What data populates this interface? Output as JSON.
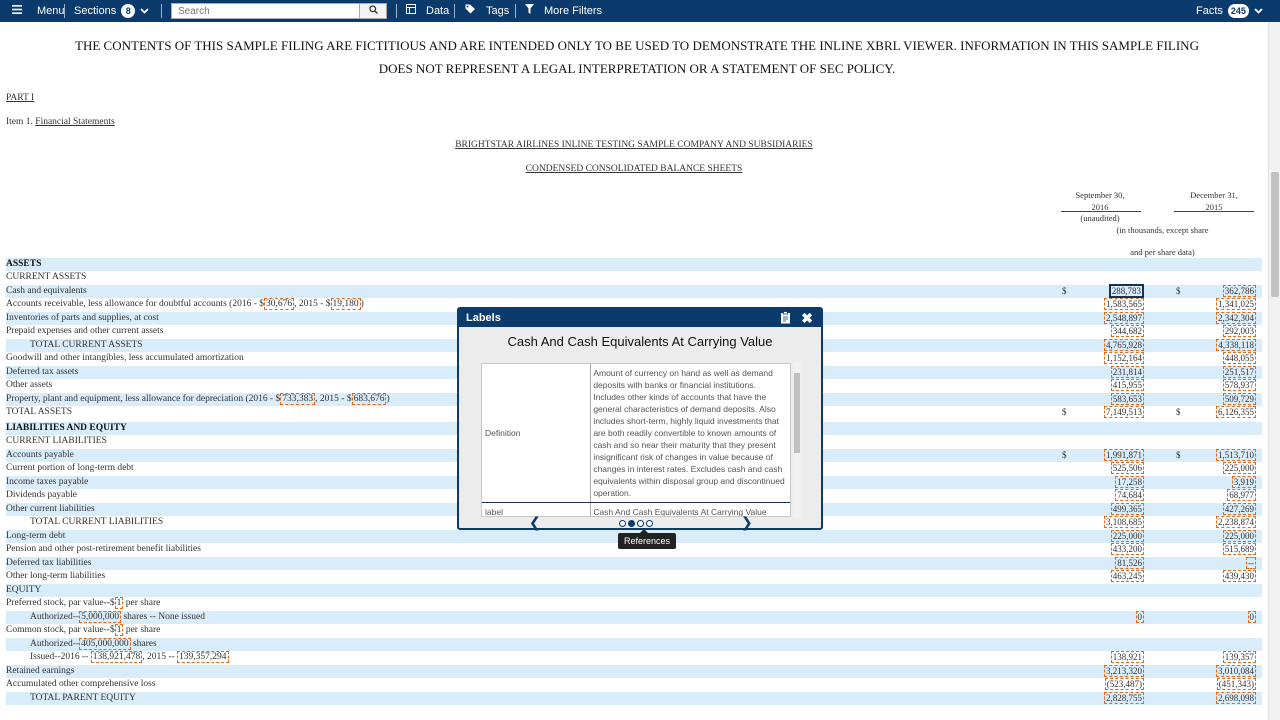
{
  "nav": {
    "menu": "Menu",
    "sections": "Sections",
    "sections_count": "8",
    "search_placeholder": "Search",
    "data": "Data",
    "tags": "Tags",
    "more_filters": "More Filters",
    "facts": "Facts",
    "facts_count": "245"
  },
  "doc": {
    "disclaimer_1": "THE CONTENTS OF THIS SAMPLE FILING ARE FICTITIOUS AND ARE INTENDED ONLY TO BE USED TO DEMONSTRATE THE INLINE XBRL VIEWER. INFORMATION IN THIS SAMPLE FILING",
    "disclaimer_2": "DOES NOT REPRESENT A LEGAL INTERPRETATION OR A STATEMENT OF SEC POLICY.",
    "part": "PART I",
    "item_prefix": "Item 1. ",
    "item_link": "Financial Statements",
    "company": "BRIGHTSTAR AIRLINES INLINE TESTING SAMPLE COMPANY AND SUBSIDIARIES",
    "statement": "CONDENSED CONSOLIDATED BALANCE SHEETS",
    "col1_line1": "September 30,",
    "col1_line2": "2016",
    "col1_line3": "(unaudited)",
    "col2_line1": "December 31,",
    "col2_line2": "2015",
    "units_line1": "(in thousands, except share",
    "units_line2": "and per share data)"
  },
  "rows": [
    {
      "label": "ASSETS"
    },
    {
      "label": "CURRENT ASSETS"
    },
    {
      "label": "Cash and equivalents",
      "d1": "$",
      "v1": "288,783",
      "d2": "$",
      "v2": "362,786"
    },
    {
      "label": "Accounts receivable, less allowance for doubtful accounts (2016 - $",
      "i1": "30,676",
      "mid": ", 2015 - $",
      "i2": "19,180",
      "end": ")",
      "v1": "1,583,565",
      "v2": "1,341,025"
    },
    {
      "label": "Inventories of parts and supplies, at cost",
      "v1": "2,548,897",
      "v2": "2,342,304"
    },
    {
      "label": "Prepaid expenses and other current assets",
      "v1": "344,682",
      "v2": "292,003"
    },
    {
      "label": "TOTAL CURRENT ASSETS",
      "v1": "4,765,928",
      "v2": "4,338,118"
    },
    {
      "label": "Goodwill and other intangibles, less accumulated amortization",
      "v1": "1,152,164",
      "v2": "448,055"
    },
    {
      "label": "Deferred tax assets",
      "v1": "231,814",
      "v2": "251,517"
    },
    {
      "label": "Other assets",
      "v1": "415,955",
      "v2": "578,937"
    },
    {
      "label": "Property, plant and equipment, less allowance for depreciation (2016 - $",
      "i1": "733,383",
      "mid": ", 2015 - $",
      "i2": "683,676",
      "end": ")",
      "v1": "583,653",
      "v2": "509,729"
    },
    {
      "label": "TOTAL ASSETS",
      "d1": "$",
      "v1": "7,149,513",
      "d2": "$",
      "v2": "6,126,355"
    },
    {
      "label": "LIABILITIES AND EQUITY"
    },
    {
      "label": "CURRENT LIABILITIES"
    },
    {
      "label": "Accounts payable",
      "d1": "$",
      "v1": "1,991,871",
      "d2": "$",
      "v2": "1,513,710"
    },
    {
      "label": "Current portion of long-term debt",
      "v1": "525,506",
      "v2": "225,000"
    },
    {
      "label": "Income taxes payable",
      "v1": "17,258",
      "v2": "3,919"
    },
    {
      "label": "Dividends payable",
      "v1": "74,684",
      "v2": "68,977"
    },
    {
      "label": "Other current liabilities",
      "v1": "499,365",
      "v2": "427,269"
    },
    {
      "label": "TOTAL CURRENT LIABILITIES",
      "v1": "3,108,685",
      "v2": "2,238,874"
    },
    {
      "label": "Long-term debt",
      "v1": "225,000",
      "v2": "225,000"
    },
    {
      "label": "Pension and other post-retirement benefit liabilities",
      "v1": "433,200",
      "v2": "515,689"
    },
    {
      "label": "Deferred tax liabilities",
      "v1": "81,526",
      "v2": "--"
    },
    {
      "label": "Other long-term liabilities",
      "v1": "463,245",
      "v2": "439,430"
    },
    {
      "label": "EQUITY"
    },
    {
      "label": "Preferred stock, par value--$",
      "i1": "1",
      "end": " per share"
    },
    {
      "label": "Authorized--",
      "i1": "5,000,000",
      "end": " shares -- None issued",
      "v1": "0",
      "v2": "0"
    },
    {
      "label": "Common stock, par value--$",
      "i1": "1",
      "end": " per share"
    },
    {
      "label": "Authorized--",
      "i1": "405,000,000",
      "end": " shares"
    },
    {
      "label": "Issued--2016 -- ",
      "i1": "138,921,478",
      "mid": ", 2015 -- ",
      "i2": "139,357,294",
      "v1": "138,921",
      "v2": "139,357"
    },
    {
      "label": "Retained earnings",
      "v1": "3,213,320",
      "v2": "3,010,084"
    },
    {
      "label": "Accumulated other comprehensive loss",
      "v1": "(523,487)",
      "v2": "(451,343)"
    },
    {
      "label": "TOTAL PARENT EQUITY",
      "v1": "2,828,755",
      "v2": "2,698,098"
    }
  ],
  "popup": {
    "header": "Labels",
    "title": "Cash And Cash Equivalents At Carrying Value",
    "definition_key": "Definition",
    "definition_value": "Amount of currency on hand as well as demand deposits with banks or financial institutions. Includes other kinds of accounts that have the general characteristics of demand deposits. Also includes short-term, highly liquid investments that are both readily convertible to known amounts of cash and so near their maturity that they present insignificant risk of changes in value because of changes in interest rates. Excludes cash and cash equivalents within disposal group and discontinued operation.",
    "label_key": "label",
    "label_value": "Cash And Cash Equivalents At Carrying Value",
    "tooltip": "References"
  }
}
